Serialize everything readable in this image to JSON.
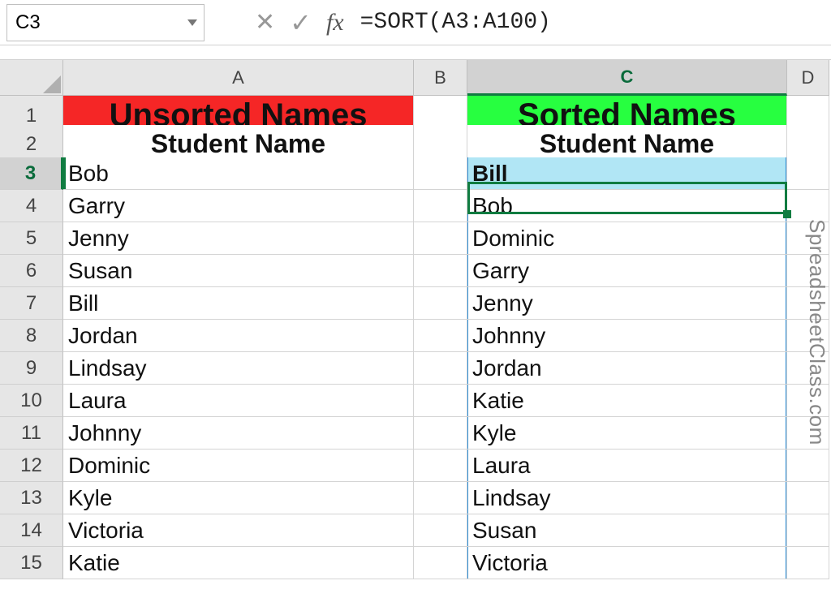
{
  "formula_bar": {
    "cell_ref": "C3",
    "formula": "=SORT(A3:A100)",
    "fx_label": "fx"
  },
  "columns": {
    "A": "A",
    "B": "B",
    "C": "C",
    "D": "D"
  },
  "headers": {
    "unsorted_title": "Unsorted Names",
    "sorted_title": "Sorted Names",
    "subhead_a": "Student Name",
    "subhead_c": "Student Name"
  },
  "rows": [
    {
      "n": "3",
      "a": "Bob",
      "c": "Bill"
    },
    {
      "n": "4",
      "a": "Garry",
      "c": "Bob"
    },
    {
      "n": "5",
      "a": "Jenny",
      "c": "Dominic"
    },
    {
      "n": "6",
      "a": "Susan",
      "c": "Garry"
    },
    {
      "n": "7",
      "a": "Bill",
      "c": "Jenny"
    },
    {
      "n": "8",
      "a": "Jordan",
      "c": "Johnny"
    },
    {
      "n": "9",
      "a": "Lindsay",
      "c": "Jordan"
    },
    {
      "n": "10",
      "a": "Laura",
      "c": "Katie"
    },
    {
      "n": "11",
      "a": "Johnny",
      "c": "Kyle"
    },
    {
      "n": "12",
      "a": "Dominic",
      "c": "Laura"
    },
    {
      "n": "13",
      "a": "Kyle",
      "c": "Lindsay"
    },
    {
      "n": "14",
      "a": "Victoria",
      "c": "Susan"
    },
    {
      "n": "15",
      "a": "Katie",
      "c": "Victoria"
    }
  ],
  "row_labels": {
    "r1": "1",
    "r2": "2"
  },
  "watermark": "SpreadsheetClass.com"
}
